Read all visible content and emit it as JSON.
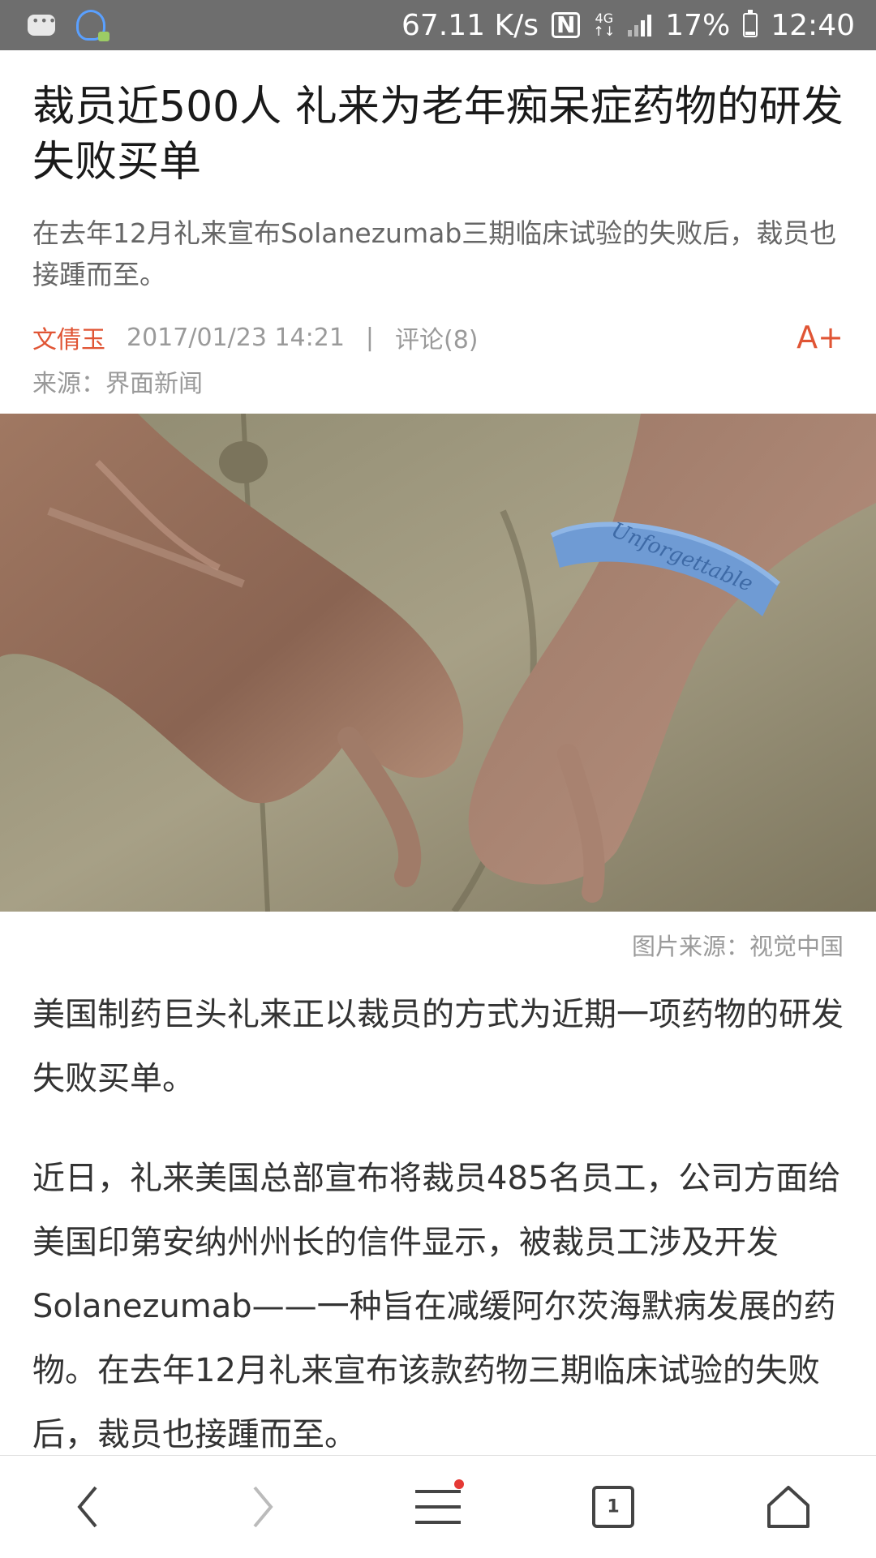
{
  "status_bar": {
    "speed": "67.11 K/s",
    "nfc": "N",
    "network_top": "4G",
    "network_bottom": "↑↓",
    "battery": "17%",
    "battery_level": 0.17,
    "time": "12:40",
    "icons": [
      "chat-bubble-icon",
      "app-notification-icon",
      "nfc-icon",
      "signal-icon",
      "battery-icon"
    ]
  },
  "article": {
    "title": "裁员近500人 礼来为老年痴呆症药物的研发失败买单",
    "summary": "在去年12月礼来宣布Solanezumab三期临床试验的失败后，裁员也接踵而至。",
    "author": "文倩玉",
    "date": "2017/01/23 14:21",
    "separator": "|",
    "comments": "评论(8)",
    "font_size_button": "A+",
    "source": "来源：界面新闻",
    "image_caption": "图片来源：视觉中国",
    "wristband_text": "Unforgettable",
    "paragraphs": [
      "美国制药巨头礼来正以裁员的方式为近期一项药物的研发失败买单。",
      "近日，礼来美国总部宣布将裁员485名员工，公司方面给美国印第安纳州州长的信件显示，被裁员工涉及开发Solanezumab——一种旨在减缓阿尔茨海默病发展的药物。在去年12月礼来宣布该款药物三期临床试验的失败后，裁员也接踵而至。"
    ]
  },
  "bottom_nav": {
    "tab_count": "1",
    "icons": [
      "back-icon",
      "forward-icon",
      "menu-icon",
      "tabs-icon",
      "home-icon"
    ],
    "accent": "#e53935"
  },
  "colors": {
    "accent": "#e05535",
    "status_bar": "#6e6e6e"
  }
}
